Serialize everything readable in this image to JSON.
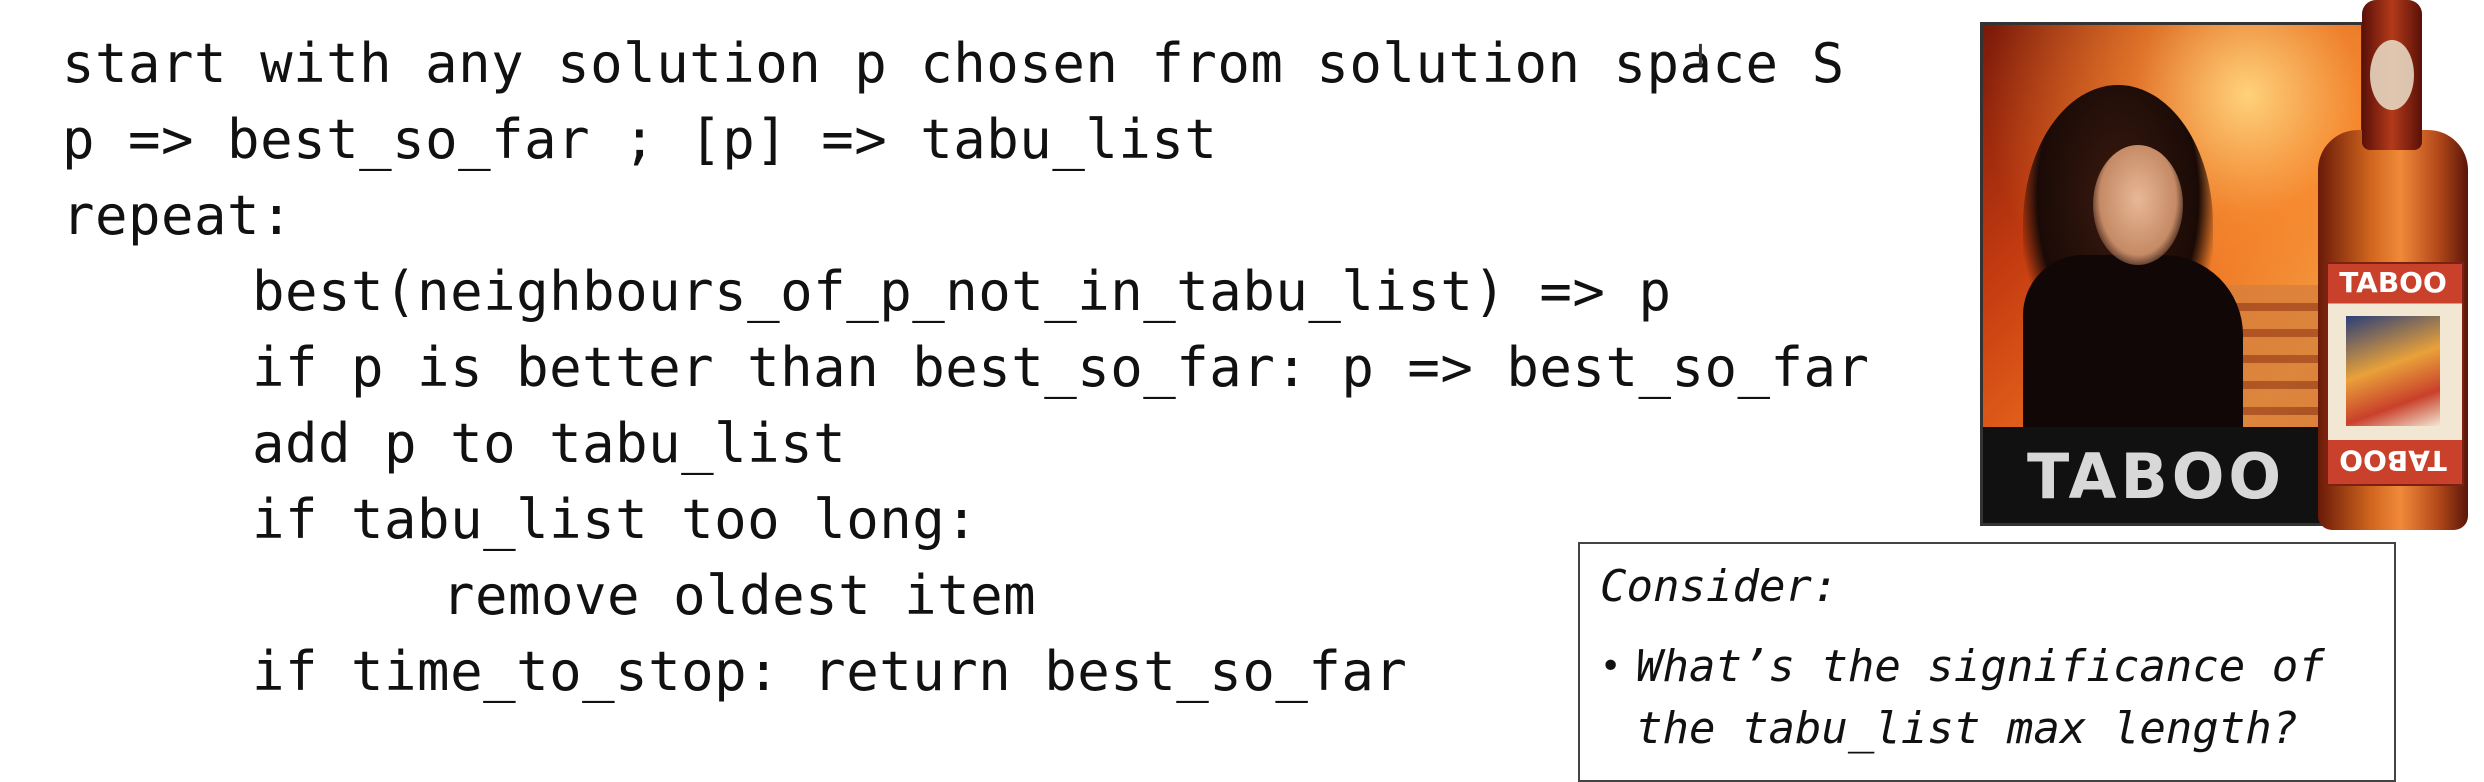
{
  "code": {
    "lines": [
      "start with any solution p chosen from solution space S",
      "p => best_so_far ; [p] => tabu_list",
      "repeat:",
      "best(neighbours_of_p_not_in_tabu_list) => p",
      "if p is better than best_so_far: p => best_so_far",
      "add p to tabu_list",
      "if tabu_list too long:",
      "remove oldest item",
      "if time_to_stop: return best_so_far"
    ]
  },
  "image": {
    "poster_title": "TABOO",
    "bottle_label": "TABOO"
  },
  "note": {
    "title": "Consider:",
    "bullet": "•",
    "items": [
      "What’s the significance of the tabu_list max length?"
    ]
  },
  "colors": {
    "text": "#111111",
    "background": "#ffffff"
  }
}
